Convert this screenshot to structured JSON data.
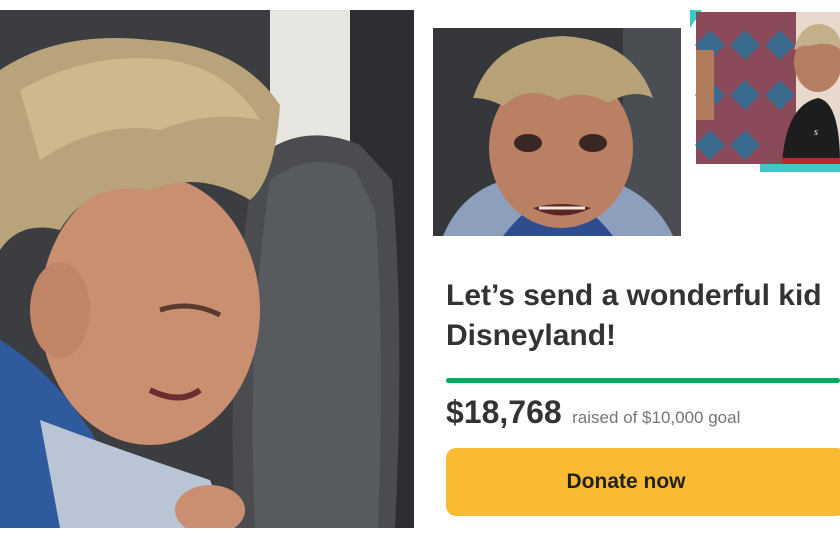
{
  "campaign": {
    "title_line1": "Let’s send a wonderful kid",
    "title_line2": "Disneyland!",
    "raised_amount": "$18,768",
    "raised_text": "raised of $10,000 goal",
    "progress_fraction": 1.0,
    "donate_label": "Donate now"
  },
  "colors": {
    "progress": "#02a95c",
    "donate_button": "#f9ba34",
    "accent_teal": "#3ec8c8"
  }
}
